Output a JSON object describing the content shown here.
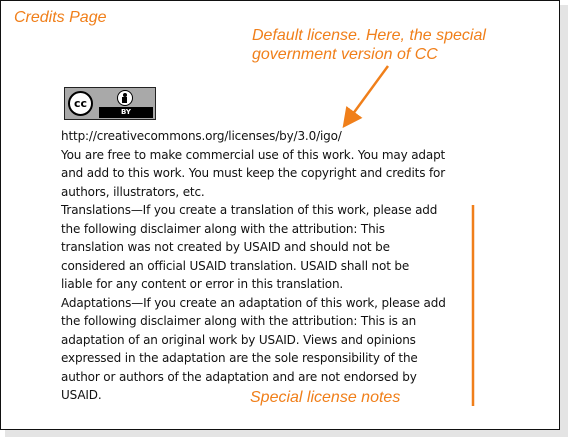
{
  "annotations": {
    "page_title": "Credits Page",
    "default_license_line1": "Default license. Here, the special",
    "default_license_line2": "government version of CC",
    "special_notes": "Special license notes"
  },
  "badge": {
    "cc_text": "cc",
    "by_text": "BY"
  },
  "content": {
    "url": "http://creativecommons.org/licenses/by/3.0/igo/",
    "lines": [
      "You are free to make commercial use of this work. You may adapt",
      "and add to this work. You must keep the copyright and credits for",
      "authors, illustrators, etc.",
      "Translations—If you create a translation of this work, please add",
      "the following disclaimer along with the attribution: This",
      "translation was not created by USAID and should not be",
      "considered an official USAID translation. USAID shall not be",
      "liable for any content or error in this translation.",
      "Adaptations—If you create an adaptation of this work, please add",
      "the following disclaimer along with the attribution: This is an",
      "adaptation of an original work by USAID. Views and opinions",
      "expressed in the adaptation are the sole responsibility of the",
      "author or authors of the adaptation and are not endorsed by",
      "USAID."
    ]
  },
  "colors": {
    "annotation": "#f07f1a",
    "badge_bg": "#a9a9a9"
  }
}
